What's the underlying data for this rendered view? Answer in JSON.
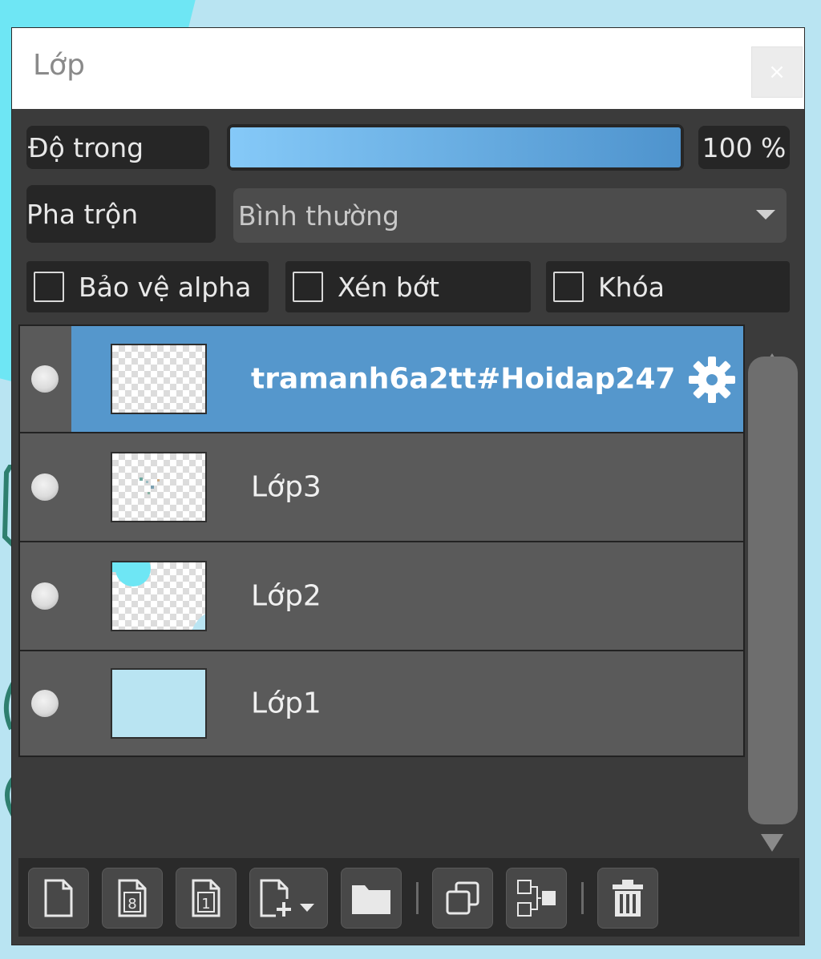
{
  "window": {
    "title": "Lớp",
    "close_label": "×"
  },
  "opacity": {
    "label": "Độ trong",
    "value_text": "100 %",
    "fraction": 1.0
  },
  "blend": {
    "label": "Pha trộn",
    "selected": "Bình thường"
  },
  "options": [
    {
      "label": "Bảo vệ alpha",
      "checked": false
    },
    {
      "label": "Xén bớt",
      "checked": false
    },
    {
      "label": "Khóa",
      "checked": false
    }
  ],
  "layers": [
    {
      "name": "tramanh6a2tt#Hoidap247",
      "selected": true
    },
    {
      "name": "Lớp3",
      "selected": false
    },
    {
      "name": "Lớp2",
      "selected": false
    },
    {
      "name": "Lớp1",
      "selected": false
    }
  ],
  "toolbar": {
    "icons": [
      "new-layer-icon",
      "new-8bit-layer-icon",
      "new-1bit-layer-icon",
      "add-layer-dropdown-icon",
      "new-folder-icon",
      "duplicate-layer-icon",
      "merge-layer-icon",
      "delete-layer-icon"
    ],
    "icon_8bit_text": "8",
    "icon_1bit_text": "1"
  },
  "colors": {
    "selection": "#5597cc",
    "panel": "#3b3b3b",
    "canvas": "#b9e4f2",
    "slider_start": "#85c9f8",
    "slider_end": "#4e93cd"
  }
}
